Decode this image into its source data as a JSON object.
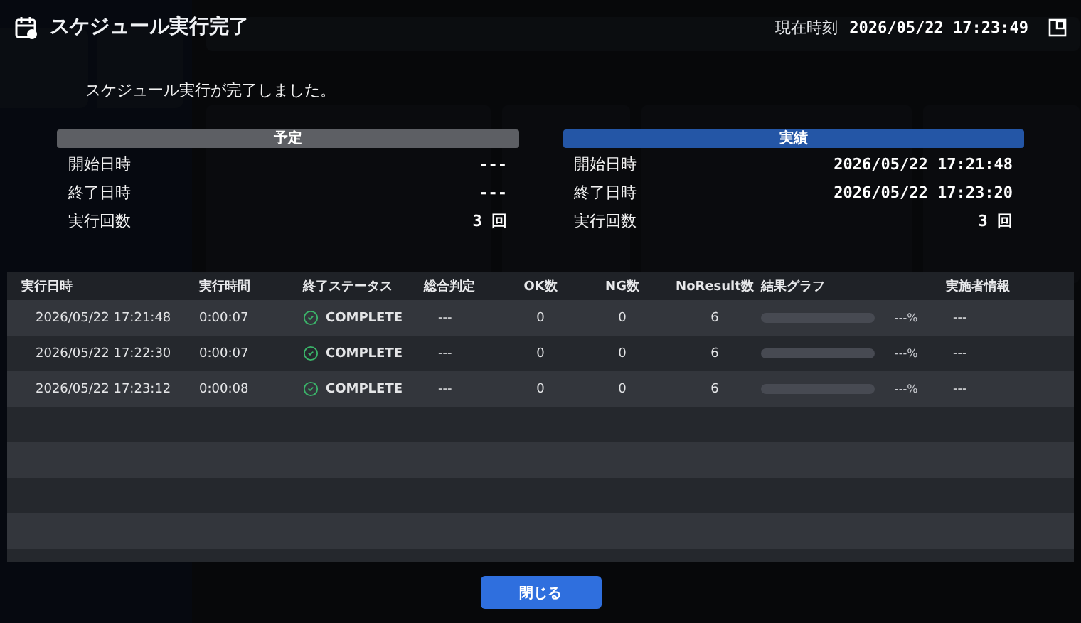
{
  "dialog": {
    "title": "スケジュール実行完了",
    "clock_label": "現在時刻",
    "clock": "2026/05/22 17:23:49",
    "message": "スケジュール実行が完了しました。",
    "panels": [
      {
        "kind": "plan",
        "title": "予定",
        "rows": [
          {
            "label": "開始日時",
            "value": "---"
          },
          {
            "label": "終了日時",
            "value": "---"
          },
          {
            "label": "実行回数",
            "value": "3 回"
          }
        ]
      },
      {
        "kind": "actual",
        "title": "実績",
        "rows": [
          {
            "label": "開始日時",
            "value": "2026/05/22 17:21:48"
          },
          {
            "label": "終了日時",
            "value": "2026/05/22 17:23:20"
          },
          {
            "label": "実行回数",
            "value": "3 回"
          }
        ]
      }
    ],
    "table": {
      "columns": [
        "実行日時",
        "実行時間",
        "終了ステータス",
        "総合判定",
        "OK数",
        "NG数",
        "NoResult数",
        "結果グラフ",
        "実施者情報"
      ],
      "rows": [
        {
          "date": "2026/05/22 17:21:48",
          "duration": "0:00:07",
          "status": "COMPLETE",
          "judgement": "---",
          "ok": "0",
          "ng": "0",
          "no_result": "6",
          "level": 0,
          "percent": "---%",
          "operator": "---"
        },
        {
          "date": "2026/05/22 17:22:30",
          "duration": "0:00:07",
          "status": "COMPLETE",
          "judgement": "---",
          "ok": "0",
          "ng": "0",
          "no_result": "6",
          "level": 0,
          "percent": "---%",
          "operator": "---"
        },
        {
          "date": "2026/05/22 17:23:12",
          "duration": "0:00:08",
          "status": "COMPLETE",
          "judgement": "---",
          "ok": "0",
          "ng": "0",
          "no_result": "6",
          "level": 0,
          "percent": "---%",
          "operator": "---"
        }
      ]
    },
    "close_button": "閉じる"
  }
}
